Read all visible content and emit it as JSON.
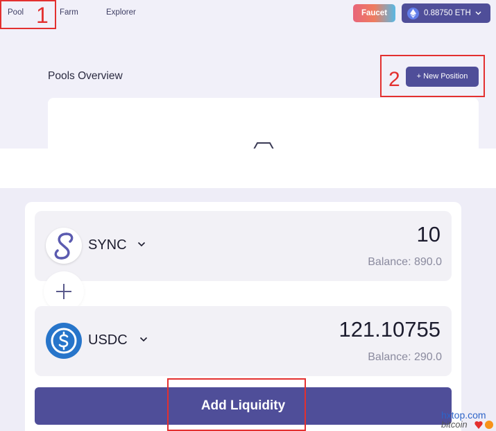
{
  "nav": {
    "pool": "Pool",
    "farm": "Farm",
    "explorer": "Explorer"
  },
  "header": {
    "faucet_label": "Faucet",
    "wallet_balance": "0.88750 ETH",
    "wallet_icon": "ethereum-icon",
    "chevron_icon": "chevron-down-icon"
  },
  "pools": {
    "title": "Pools Overview",
    "new_position_label": "+ New Position"
  },
  "annotations": {
    "marker_1": "1",
    "marker_2": "2",
    "color": "#e3302f"
  },
  "liquidity": {
    "token_a": {
      "symbol": "SYNC",
      "amount": "10",
      "balance": "Balance: 890.0",
      "icon": "sync-token-icon"
    },
    "plus_icon": "plus-icon",
    "token_b": {
      "symbol": "USDC",
      "amount": "121.10755",
      "balance": "Balance: 290.0",
      "icon": "usdc-token-icon"
    },
    "add_label": "Add Liquidity"
  },
  "colors": {
    "accent": "#4f4e99",
    "panel_bg": "#f1f0f9",
    "row_bg": "#f2f1f6",
    "usdc_blue": "#2775ca",
    "eth_blue": "#627eea"
  },
  "watermark": {
    "line1": "hxtop.com",
    "line2": "bitcoin"
  }
}
